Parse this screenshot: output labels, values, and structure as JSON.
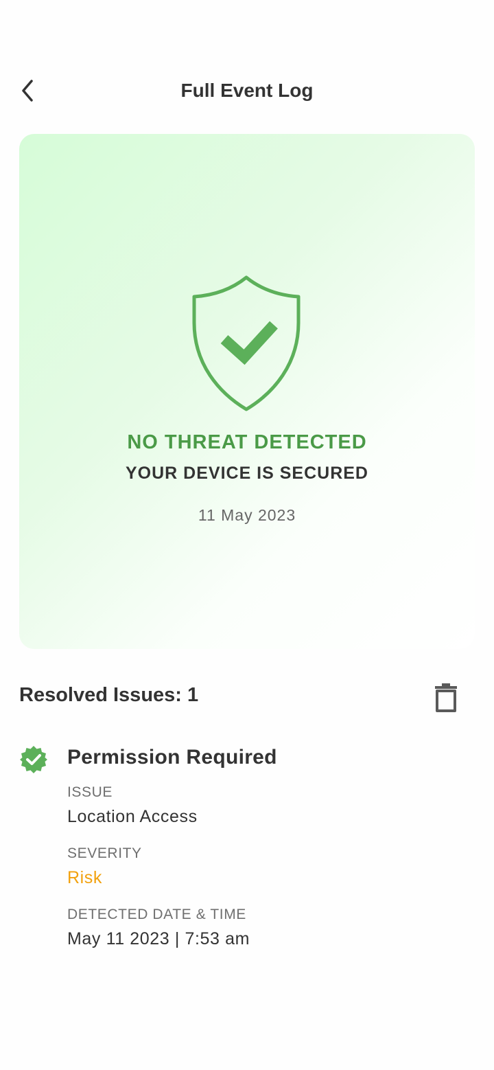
{
  "header": {
    "title": "Full Event Log",
    "back_icon": "chevron-left-icon"
  },
  "status_card": {
    "icon": "shield-check-icon",
    "title": "NO THREAT DETECTED",
    "subtitle": "YOUR DEVICE IS SECURED",
    "date": "11 May 2023",
    "colors": {
      "accent": "#4a9a47",
      "shield": "#5cb05a",
      "gradient_start": "#d6fcd8"
    }
  },
  "resolved": {
    "label": "Resolved Issues: 1",
    "delete_icon": "trash-icon"
  },
  "issues": [
    {
      "icon": "verified-badge-icon",
      "title": "Permission Required",
      "issue_label": "ISSUE",
      "issue_value": "Location Access",
      "severity_label": "SEVERITY",
      "severity_value": "Risk",
      "severity_color": "#f2a10e",
      "detected_label": "DETECTED DATE & TIME",
      "detected_value": "May 11 2023 | 7:53 am"
    }
  ]
}
